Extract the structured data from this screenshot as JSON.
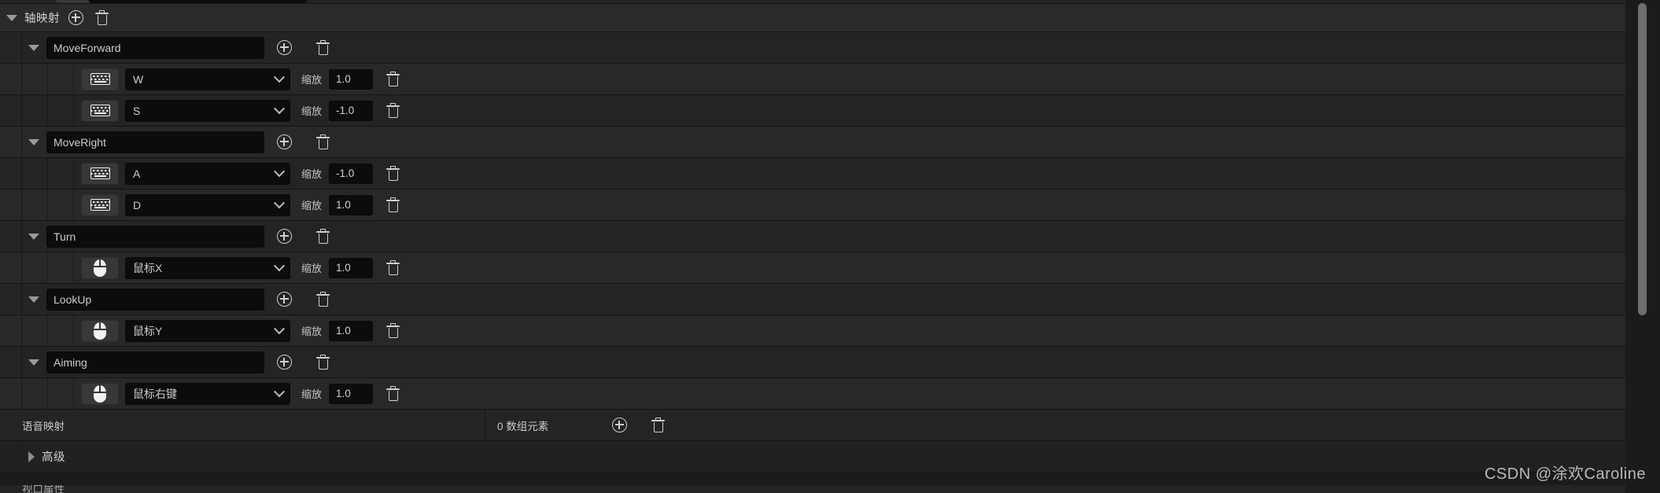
{
  "section": {
    "title": "轴映射",
    "add_icon": "plus-circle-icon",
    "delete_icon": "trash-icon"
  },
  "axis_mappings": [
    {
      "name": "MoveForward",
      "bindings": [
        {
          "device": "keyboard",
          "key": "W",
          "scale_label": "缩放",
          "scale": "1.0"
        },
        {
          "device": "keyboard",
          "key": "S",
          "scale_label": "缩放",
          "scale": "-1.0"
        }
      ]
    },
    {
      "name": "MoveRight",
      "bindings": [
        {
          "device": "keyboard",
          "key": "A",
          "scale_label": "缩放",
          "scale": "-1.0"
        },
        {
          "device": "keyboard",
          "key": "D",
          "scale_label": "缩放",
          "scale": "1.0"
        }
      ]
    },
    {
      "name": "Turn",
      "bindings": [
        {
          "device": "mouse",
          "key": "鼠标X",
          "scale_label": "缩放",
          "scale": "1.0"
        }
      ]
    },
    {
      "name": "LookUp",
      "bindings": [
        {
          "device": "mouse",
          "key": "鼠标Y",
          "scale_label": "缩放",
          "scale": "1.0"
        }
      ]
    },
    {
      "name": "Aiming",
      "bindings": [
        {
          "device": "mouse",
          "key": "鼠标右键",
          "scale_label": "缩放",
          "scale": "1.0"
        }
      ]
    }
  ],
  "speech_mapping": {
    "label": "语音映射",
    "value": "0 数组元素",
    "add_icon": "plus-circle-icon",
    "delete_icon": "trash-icon"
  },
  "advanced": {
    "label": "高级"
  },
  "partial_bottom": {
    "label": "视口属性"
  },
  "watermark": "CSDN @涂欢Caroline",
  "colors": {
    "panel_bg": "#1b1b1b",
    "row_bg": "#242424",
    "row_alt_bg": "#282828",
    "field_bg": "#0c0c0c",
    "device_btn_bg": "#383838",
    "text": "#cccccc",
    "scrollbar": "#6e6e6e"
  }
}
